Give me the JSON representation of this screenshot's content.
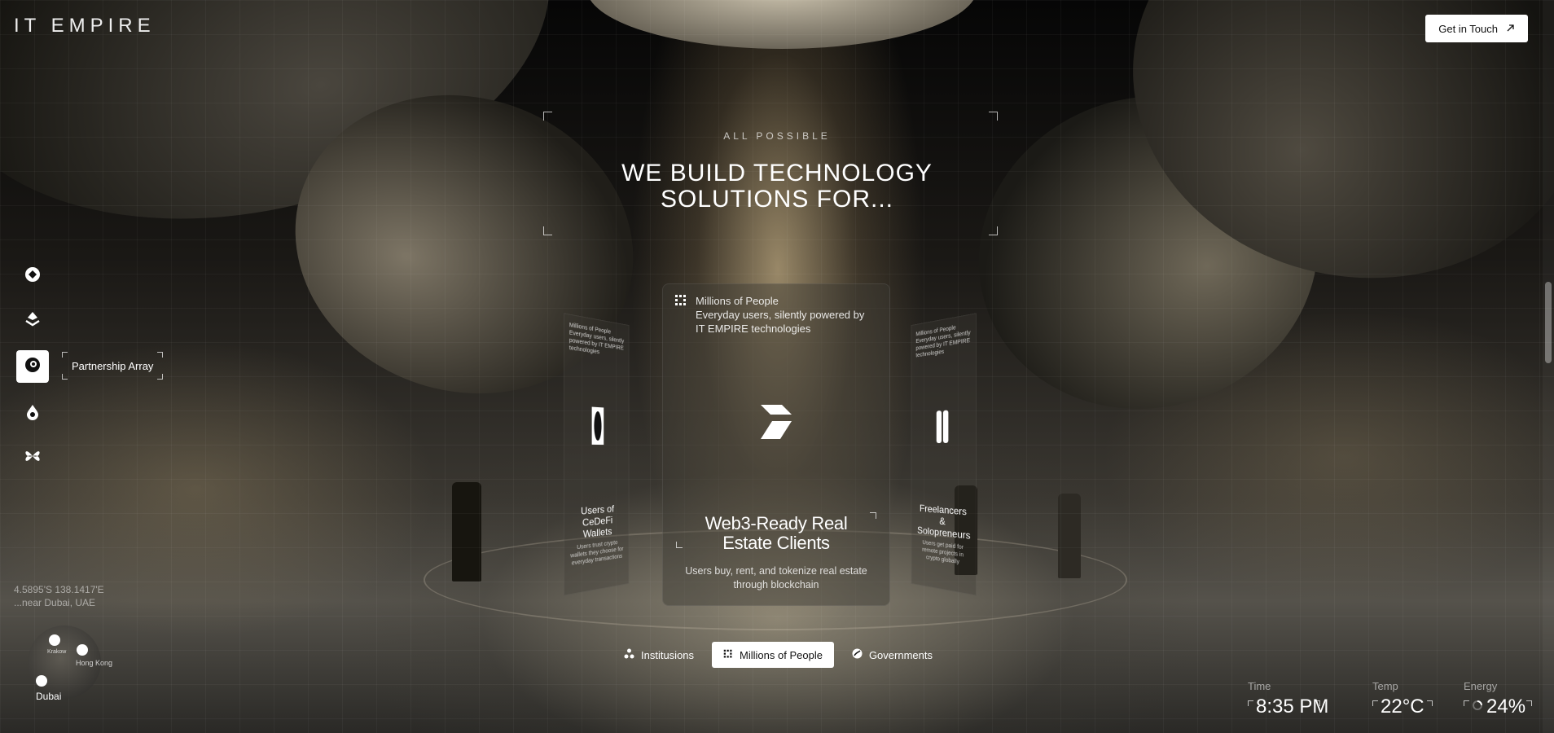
{
  "brand": {
    "logo_text": "IT EMPIRE"
  },
  "header": {
    "cta_label": "Get in Touch",
    "cta_icon": "arrow-up-right-icon"
  },
  "hero": {
    "eyebrow": "ALL POSSIBLE",
    "headline_line1": "WE BUILD TECHNOLOGY",
    "headline_line2": "SOLUTIONS FOR..."
  },
  "side_nav": {
    "items": [
      {
        "icon": "hex-logo-icon"
      },
      {
        "icon": "chevron-layers-icon"
      },
      {
        "icon": "swirl-icon",
        "label": "Partnership Array",
        "active": true
      },
      {
        "icon": "drop-icon"
      },
      {
        "icon": "petals-icon"
      }
    ]
  },
  "location": {
    "coords": "4.5895'S 138.1417'E",
    "place": "...near Dubai, UAE",
    "cities": [
      "Krakow",
      "Hong Kong",
      "Dubai"
    ]
  },
  "cards": {
    "left": {
      "top_text": "Millions of People Everyday users, silently powered by IT EMPIRE technologies",
      "title": "Users of CeDeFi Wallets",
      "desc": "Users trust crypto wallets they choose for everyday transactions"
    },
    "center": {
      "top_title": "Millions of People",
      "top_desc": "Everyday users, silently powered by IT EMPIRE technologies",
      "title": "Web3-Ready Real Estate Clients",
      "desc": "Users buy, rent, and tokenize real estate through blockchain"
    },
    "right": {
      "top_text": "Millions of People Everyday users, silently powered by IT EMPIRE technologies",
      "title": "Freelancers & Solopreneurs",
      "desc": "Users get paid for remote projects in crypto globally"
    }
  },
  "tabs": [
    {
      "label": "Institusions",
      "icon": "nodes-icon",
      "active": false
    },
    {
      "label": "Millions of People",
      "icon": "dots-grid-icon",
      "active": true
    },
    {
      "label": "Governments",
      "icon": "globe-icon",
      "active": false
    }
  ],
  "stats": {
    "time": {
      "label": "Time",
      "value": "8:35 PM"
    },
    "temp": {
      "label": "Temp",
      "value": "22°C"
    },
    "energy": {
      "label": "Energy",
      "value": "24%",
      "level": 0.24
    }
  }
}
